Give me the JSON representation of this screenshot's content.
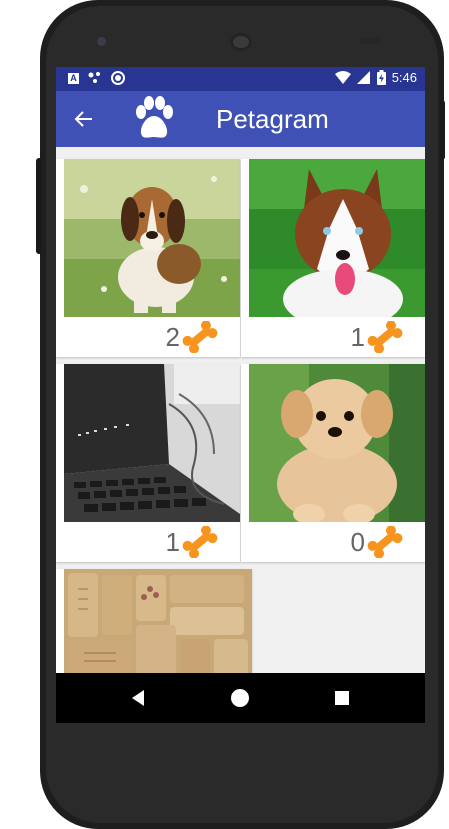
{
  "status_bar": {
    "time": "5:46",
    "left_icons": [
      "a-box-icon",
      "dots-icon",
      "circle-icon"
    ],
    "right_icons": [
      "wifi-icon",
      "signal-icon",
      "battery-icon"
    ]
  },
  "toolbar": {
    "title": "Petagram",
    "back_icon": "arrow-back-icon",
    "logo_icon": "paw-icon",
    "background": "#3f51b5",
    "status_background": "#283593"
  },
  "pets": [
    {
      "name": "beagle",
      "likes": "2"
    },
    {
      "name": "husky",
      "likes": "1"
    },
    {
      "name": "laptop",
      "likes": "1"
    },
    {
      "name": "puppy",
      "likes": "0"
    },
    {
      "name": "corks",
      "likes": ""
    }
  ],
  "colors": {
    "bone": "#f7941d",
    "count_text": "#666666"
  },
  "nav_bar": {
    "buttons": [
      "back-triangle-icon",
      "home-circle-icon",
      "recents-square-icon"
    ]
  }
}
